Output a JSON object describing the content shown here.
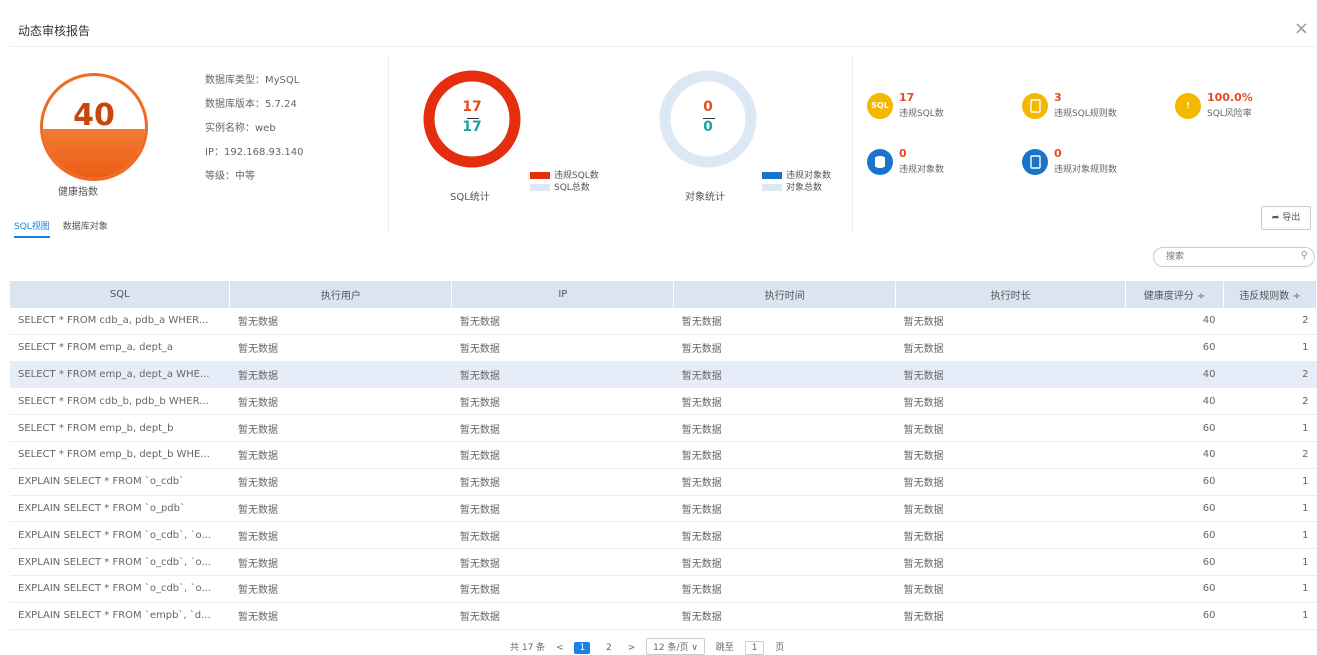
{
  "dialog": {
    "title": "动态审核报告",
    "close_glyph": "×"
  },
  "health": {
    "score": "40",
    "label": "健康指数"
  },
  "db_info": {
    "type": "数据库类型：MySQL",
    "version": "数据库版本：5.7.24",
    "instance": "实例名称：web",
    "ip": "IP：192.168.93.140",
    "level": "等级：中等"
  },
  "sql_stats": {
    "violations": "17",
    "total": "17",
    "caption": "SQL统计",
    "legend_violation": "违规SQL数",
    "legend_total": "SQL总数",
    "violation_fraction": 1.0,
    "color_violation": "#e52e0e",
    "color_total": "#dce8f4"
  },
  "object_stats": {
    "violations": "0",
    "total": "0",
    "caption": "对象统计",
    "legend_violation": "违规对象数",
    "legend_total": "对象总数",
    "violation_fraction": 0.0,
    "color_violation": "#1a74c9",
    "color_total": "#dce8f4"
  },
  "stat_cards": [
    {
      "value": "17",
      "label": "违规SQL数",
      "icon": "sql-icon",
      "icon_text": "SQL",
      "color": "#f5b800"
    },
    {
      "value": "3",
      "label": "违规SQL规则数",
      "icon": "document-icon",
      "icon_text": "",
      "color": "#f5b800"
    },
    {
      "value": "100.0%",
      "label": "SQL风险率",
      "icon": "warning-icon",
      "icon_text": "!",
      "color": "#f5b800"
    },
    {
      "value": "0",
      "label": "违规对象数",
      "icon": "database-icon",
      "icon_text": "",
      "color": "#1a74c9"
    },
    {
      "value": "0",
      "label": "违规对象规则数",
      "icon": "document-icon",
      "icon_text": "",
      "color": "#1a74c9"
    }
  ],
  "tabs": [
    "SQL视图",
    "数据库对象"
  ],
  "export_label": "导出",
  "search": {
    "placeholder": "搜索"
  },
  "table": {
    "headers": [
      "SQL",
      "执行用户",
      "IP",
      "执行时间",
      "执行时长",
      "健康度评分 ÷",
      "违反规则数 ÷"
    ],
    "rows": [
      [
        "SELECT * FROM cdb_a, pdb_a WHER...",
        "暂无数据",
        "暂无数据",
        "暂无数据",
        "暂无数据",
        "40",
        "2"
      ],
      [
        "SELECT * FROM emp_a, dept_a",
        "暂无数据",
        "暂无数据",
        "暂无数据",
        "暂无数据",
        "60",
        "1"
      ],
      [
        "SELECT * FROM emp_a, dept_a WHE...",
        "暂无数据",
        "暂无数据",
        "暂无数据",
        "暂无数据",
        "40",
        "2"
      ],
      [
        "SELECT * FROM cdb_b, pdb_b WHER...",
        "暂无数据",
        "暂无数据",
        "暂无数据",
        "暂无数据",
        "40",
        "2"
      ],
      [
        "SELECT * FROM emp_b, dept_b",
        "暂无数据",
        "暂无数据",
        "暂无数据",
        "暂无数据",
        "60",
        "1"
      ],
      [
        "SELECT * FROM emp_b, dept_b WHE...",
        "暂无数据",
        "暂无数据",
        "暂无数据",
        "暂无数据",
        "40",
        "2"
      ],
      [
        "EXPLAIN SELECT * FROM `o_cdb`",
        "暂无数据",
        "暂无数据",
        "暂无数据",
        "暂无数据",
        "60",
        "1"
      ],
      [
        "EXPLAIN SELECT * FROM `o_pdb`",
        "暂无数据",
        "暂无数据",
        "暂无数据",
        "暂无数据",
        "60",
        "1"
      ],
      [
        "EXPLAIN SELECT * FROM `o_cdb`, `o...",
        "暂无数据",
        "暂无数据",
        "暂无数据",
        "暂无数据",
        "60",
        "1"
      ],
      [
        "EXPLAIN SELECT * FROM `o_cdb`, `o...",
        "暂无数据",
        "暂无数据",
        "暂无数据",
        "暂无数据",
        "60",
        "1"
      ],
      [
        "EXPLAIN SELECT * FROM `o_cdb`, `o...",
        "暂无数据",
        "暂无数据",
        "暂无数据",
        "暂无数据",
        "60",
        "1"
      ],
      [
        "EXPLAIN SELECT * FROM `empb`, `d...",
        "暂无数据",
        "暂无数据",
        "暂无数据",
        "暂无数据",
        "60",
        "1"
      ]
    ],
    "selected_row": 2
  },
  "pager": {
    "total": "共 17 条",
    "prev": "<",
    "pages": [
      "1",
      "2"
    ],
    "current": "1",
    "next": ">",
    "page_size": "12 条/页 ∨",
    "jump_label": "跳至",
    "jump_value": "1",
    "page_suffix": "页"
  }
}
